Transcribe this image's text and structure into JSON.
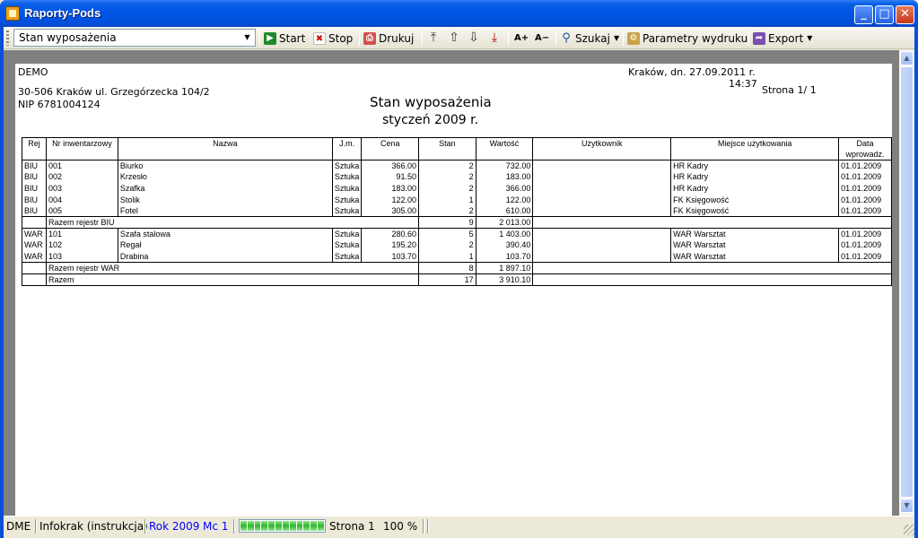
{
  "window": {
    "title": "Raporty-Pods",
    "controls": {
      "minimize": "_",
      "maximize": "□",
      "close": "✕"
    }
  },
  "toolbar": {
    "report_select": "Stan wyposażenia",
    "start": "Start",
    "stop": "Stop",
    "print": "Drukuj",
    "font_larger": "A+",
    "font_smaller": "A−",
    "search": "Szukaj",
    "print_params": "Parametry wydruku",
    "export": "Export",
    "icons": {
      "start": "play-icon",
      "stop": "stop-icon",
      "print": "printer-icon",
      "first": "first-page-icon",
      "prev": "prev-page-icon",
      "next": "next-page-icon",
      "last": "last-page-icon",
      "search": "magnifier-icon",
      "params": "settings-icon",
      "export": "export-icon"
    }
  },
  "report": {
    "company": "DEMO",
    "address": "30-506 Kraków  ul. Grzegórzecka 104/2",
    "nip": "NIP  6781004124",
    "place_date": "Kraków, dn. 27.09.2011 r.",
    "time": "14:37",
    "page": "Strona 1/ 1",
    "title": "Stan wyposażenia",
    "subtitle": "styczeń 2009 r.",
    "columns": {
      "rej": "Rej",
      "nr": "Nr inwentarzowy",
      "nazwa": "Nazwa",
      "jm": "J.m.",
      "cena": "Cena",
      "stan": "Stan",
      "wartosc": "Wartość",
      "uzytkownik": "Użytkownik",
      "miejsce": "Miejsce użytkowania",
      "data": "Data wprowadz."
    },
    "rows": [
      {
        "rej": "BIU",
        "nr": "001",
        "nazwa": "Biurko",
        "jm": "Sztuka",
        "cena": "366.00",
        "stan": "2",
        "wartosc": "732.00",
        "uzytkownik": "",
        "miejsce": "HR Kadry",
        "data": "01.01.2009"
      },
      {
        "rej": "BIU",
        "nr": "002",
        "nazwa": "Krzesło",
        "jm": "Sztuka",
        "cena": "91.50",
        "stan": "2",
        "wartosc": "183.00",
        "uzytkownik": "",
        "miejsce": "HR Kadry",
        "data": "01.01.2009"
      },
      {
        "rej": "BIU",
        "nr": "003",
        "nazwa": "Szafka",
        "jm": "Sztuka",
        "cena": "183.00",
        "stan": "2",
        "wartosc": "366.00",
        "uzytkownik": "",
        "miejsce": "HR Kadry",
        "data": "01.01.2009"
      },
      {
        "rej": "BIU",
        "nr": "004",
        "nazwa": "Stolik",
        "jm": "Sztuka",
        "cena": "122.00",
        "stan": "1",
        "wartosc": "122.00",
        "uzytkownik": "",
        "miejsce": "FK Księgowość",
        "data": "01.01.2009"
      },
      {
        "rej": "BIU",
        "nr": "005",
        "nazwa": "Fotel",
        "jm": "Sztuka",
        "cena": "305.00",
        "stan": "2",
        "wartosc": "610.00",
        "uzytkownik": "",
        "miejsce": "FK Księgowość",
        "data": "01.01.2009"
      },
      {
        "rej": "WAR",
        "nr": "101",
        "nazwa": "Szafa stalowa",
        "jm": "Sztuka",
        "cena": "280.60",
        "stan": "5",
        "wartosc": "1 403.00",
        "uzytkownik": "",
        "miejsce": "WAR Warsztat",
        "data": "01.01.2009"
      },
      {
        "rej": "WAR",
        "nr": "102",
        "nazwa": "Regał",
        "jm": "Sztuka",
        "cena": "195.20",
        "stan": "2",
        "wartosc": "390.40",
        "uzytkownik": "",
        "miejsce": "WAR Warsztat",
        "data": "01.01.2009"
      },
      {
        "rej": "WAR",
        "nr": "103",
        "nazwa": "Drabina",
        "jm": "Sztuka",
        "cena": "103.70",
        "stan": "1",
        "wartosc": "103.70",
        "uzytkownik": "",
        "miejsce": "WAR Warsztat",
        "data": "01.01.2009"
      }
    ],
    "subtotal_biu": {
      "label": "Razem rejestr BIU",
      "stan": "9",
      "wartosc": "2 013.00"
    },
    "subtotal_war": {
      "label": "Razem rejestr WAR",
      "stan": "8",
      "wartosc": "1 897.10"
    },
    "total": {
      "label": "Razem",
      "stan": "17",
      "wartosc": "3 910.10"
    }
  },
  "statusbar": {
    "db": "DME",
    "company": "Infokrak (instrukcja)",
    "year": "Rok 2009",
    "month": "Mc 1",
    "progress_percent": 100,
    "page": "Strona 1",
    "zoom": "100 %"
  },
  "colors": {
    "title_bar": "#0054e3",
    "status_blue": "#0000ff",
    "progress": "#2cb62a"
  }
}
